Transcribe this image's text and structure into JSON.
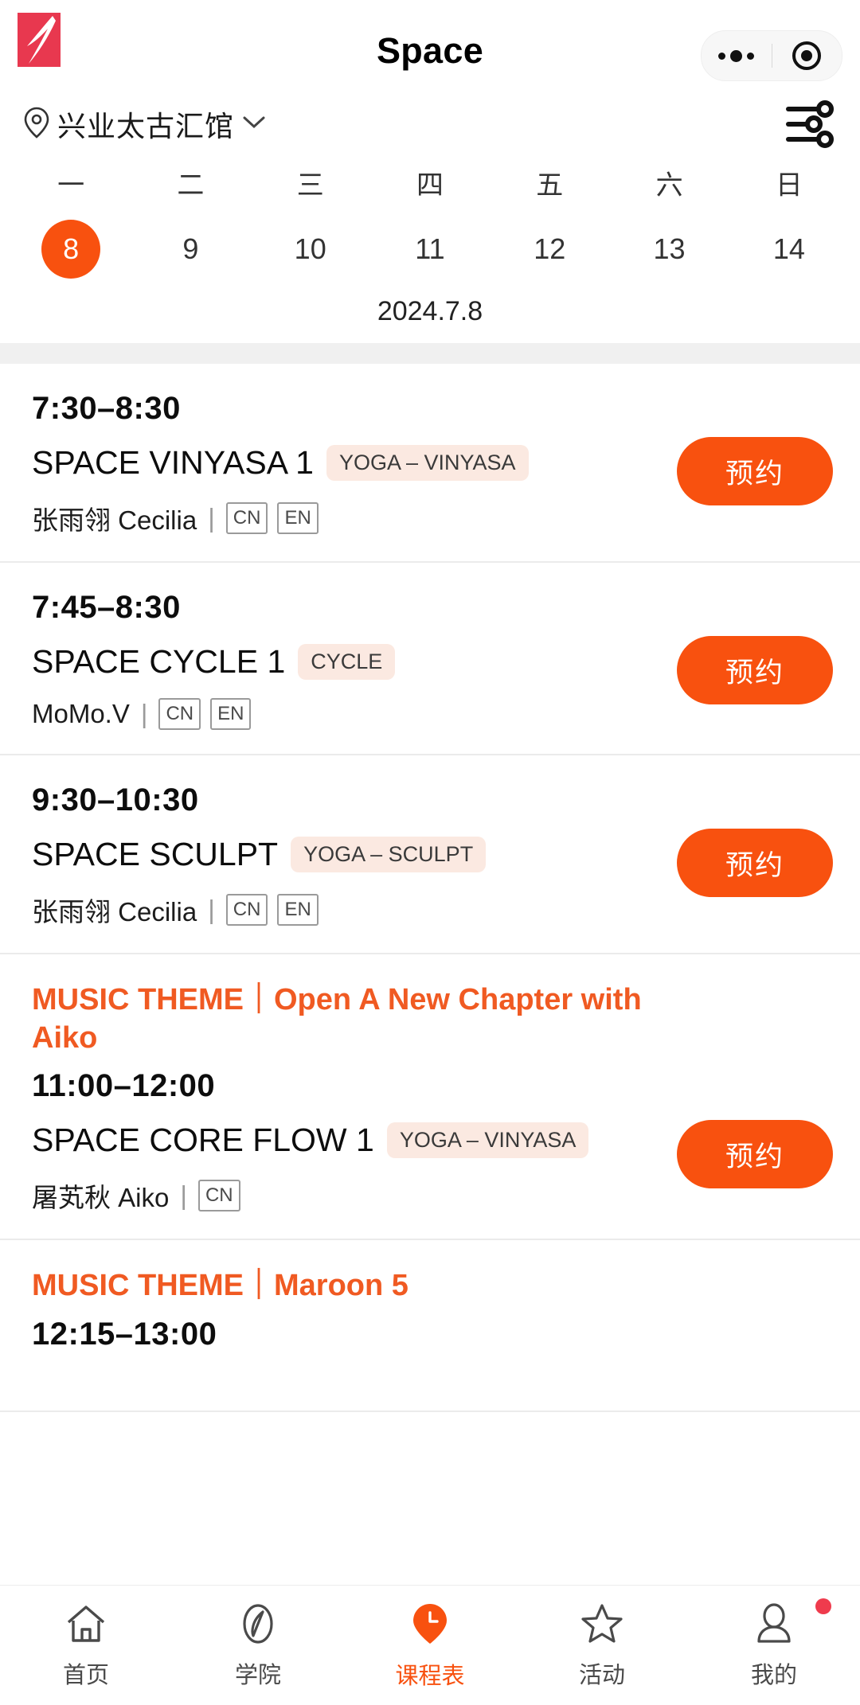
{
  "header": {
    "logo": "brand-k-logo",
    "title": "Space",
    "capsule": {
      "menu_icon": "more-dots-icon",
      "close_icon": "target-circle-icon"
    }
  },
  "location": {
    "pin_icon": "location-pin-icon",
    "name": "兴业太古汇馆",
    "chevron_icon": "chevron-down-icon",
    "filter_icon": "filter-sliders-icon"
  },
  "calendar": {
    "weekdays": [
      "一",
      "二",
      "三",
      "四",
      "五",
      "六",
      "日"
    ],
    "days": [
      "8",
      "9",
      "10",
      "11",
      "12",
      "13",
      "14"
    ],
    "selected_index": 0,
    "date_label": "2024.7.8",
    "accent_color": "#f8510f"
  },
  "classes": [
    {
      "theme": "",
      "time": "7:30–8:30",
      "name": "SPACE VINYASA 1",
      "tag": "YOGA – VINYASA",
      "teacher": "张雨翎 Cecilia",
      "languages": [
        "CN",
        "EN"
      ],
      "book_label": "预约"
    },
    {
      "theme": "",
      "time": "7:45–8:30",
      "name": "SPACE CYCLE 1",
      "tag": "CYCLE",
      "teacher": "MoMo.V",
      "languages": [
        "CN",
        "EN"
      ],
      "book_label": "预约"
    },
    {
      "theme": "",
      "time": "9:30–10:30",
      "name": "SPACE SCULPT",
      "tag": "YOGA – SCULPT",
      "teacher": "张雨翎 Cecilia",
      "languages": [
        "CN",
        "EN"
      ],
      "book_label": "预约"
    },
    {
      "theme": "MUSIC THEME｜Open A New Chapter with Aiko",
      "time": "11:00–12:00",
      "name": "SPACE CORE FLOW 1",
      "tag": "YOGA – VINYASA",
      "teacher": "屠芄秋 Aiko",
      "languages": [
        "CN"
      ],
      "book_label": "预约"
    },
    {
      "theme": "MUSIC THEME｜Maroon 5",
      "time": "12:15–13:00",
      "name": "",
      "tag": "",
      "teacher": "",
      "languages": [],
      "book_label": ""
    }
  ],
  "bottom_nav": {
    "items": [
      {
        "label": "首页",
        "icon": "home-icon",
        "active": false,
        "badge": false
      },
      {
        "label": "学院",
        "icon": "compass-icon",
        "active": false,
        "badge": false
      },
      {
        "label": "课程表",
        "icon": "schedule-clock-pin-icon",
        "active": true,
        "badge": false
      },
      {
        "label": "活动",
        "icon": "star-icon",
        "active": false,
        "badge": false
      },
      {
        "label": "我的",
        "icon": "profile-person-icon",
        "active": false,
        "badge": true
      }
    ]
  }
}
